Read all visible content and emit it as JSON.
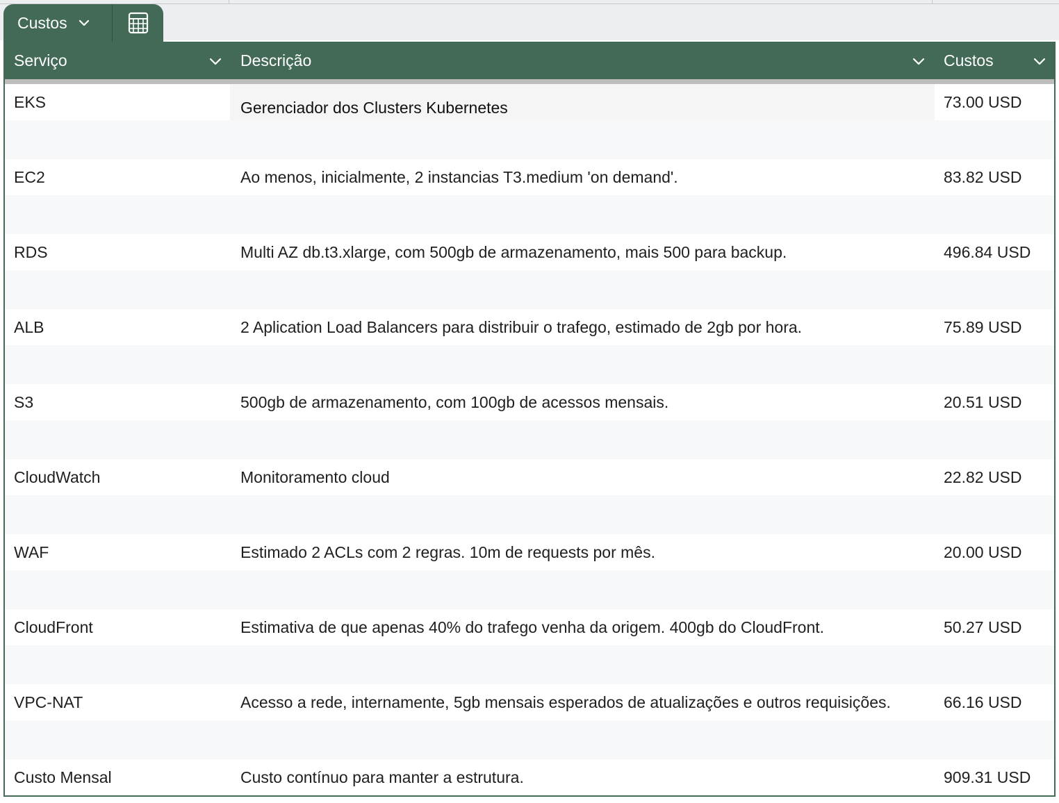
{
  "view": {
    "name": "Custos",
    "chevron_icon": "chevron-down-icon",
    "calculator_icon": "calculator-icon"
  },
  "table": {
    "columns": [
      {
        "key": "servico",
        "label": "Serviço"
      },
      {
        "key": "descricao",
        "label": "Descrição"
      },
      {
        "key": "custos",
        "label": "Custos"
      }
    ],
    "rows": [
      {
        "servico": "EKS",
        "descricao": "Gerenciador dos Clusters Kubernetes",
        "custos": "73.00 USD"
      },
      {
        "servico": "EC2",
        "descricao": "Ao menos, inicialmente, 2 instancias T3.medium 'on demand'.",
        "custos": "83.82 USD"
      },
      {
        "servico": "RDS",
        "descricao": "Multi AZ db.t3.xlarge, com 500gb de armazenamento, mais 500 para backup.",
        "custos": "496.84 USD"
      },
      {
        "servico": "ALB",
        "descricao": "2 Aplication Load Balancers para distribuir o trafego, estimado de 2gb por hora.",
        "custos": "75.89 USD"
      },
      {
        "servico": "S3",
        "descricao": "500gb de armazenamento, com 100gb de acessos mensais.",
        "custos": "20.51 USD"
      },
      {
        "servico": "CloudWatch",
        "descricao": "Monitoramento cloud",
        "custos": "22.82 USD"
      },
      {
        "servico": "WAF",
        "descricao": "Estimado 2 ACLs com 2 regras. 10m de requests por mês.",
        "custos": "20.00 USD"
      },
      {
        "servico": "CloudFront",
        "descricao": "Estimativa de que apenas 40% do trafego venha da origem. 400gb do CloudFront.",
        "custos": "50.27 USD"
      },
      {
        "servico": "VPC-NAT",
        "descricao": "Acesso a rede, internamente, 5gb mensais esperados de atualizações e outros requisições.",
        "custos": "66.16 USD"
      },
      {
        "servico": "Custo Mensal",
        "descricao": "Custo contínuo para manter a estrutura.",
        "custos": "909.31 USD"
      }
    ]
  },
  "colors": {
    "header_bg": "#436a57",
    "header_text": "#ffffff",
    "band_bg": "#f6f8fa",
    "strip_bg": "#eceef1"
  }
}
